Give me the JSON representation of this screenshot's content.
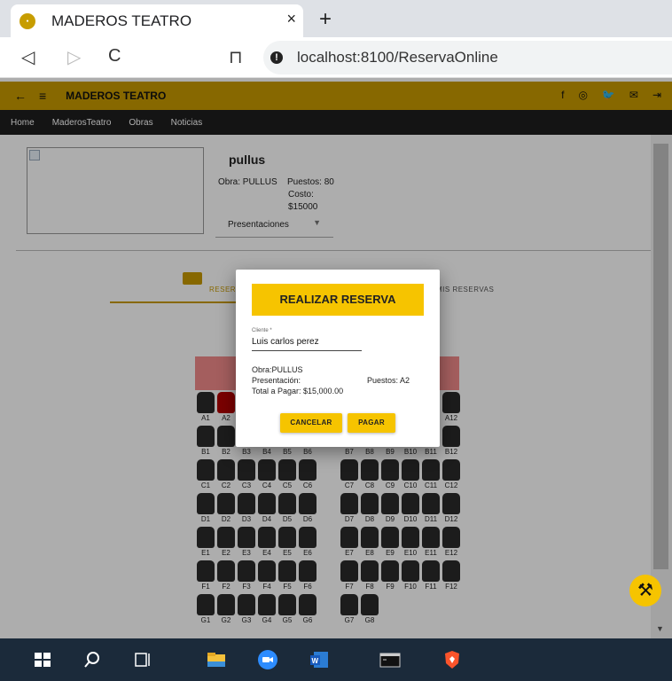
{
  "browser": {
    "tab_title": "MADEROS TEATRO",
    "tab_close": "×",
    "new_tab": "+",
    "url": "localhost:8100/ReservaOnline",
    "back": "◁",
    "forward": "▷",
    "reload": "C",
    "bookmark": "⊓",
    "info": "!"
  },
  "toolbar": {
    "back_arrow": "←",
    "menu": "≡",
    "brand": "MADEROS TEATRO",
    "social": [
      "f",
      "◎",
      "🐦",
      "✉",
      "⇥"
    ]
  },
  "menu": [
    "Home",
    "MaderosTeatro",
    "Obras",
    "Noticias"
  ],
  "obra": {
    "title": "pullus",
    "obra_line": "Obra: PULLUS",
    "puestos": "Puestos: 80",
    "costo_label": "Costo:",
    "costo_value": "$15000",
    "presentaciones": "Presentaciones"
  },
  "tabs": {
    "tab1": "RESERVAR",
    "tab2": "MIS RESERVAS"
  },
  "seats": {
    "rows": [
      "A",
      "B",
      "C",
      "D",
      "E",
      "F",
      "G"
    ],
    "left_labels": {
      "A": [
        "A1",
        "A2"
      ],
      "B": [
        "B1",
        "B2",
        "B3",
        "B4",
        "B5",
        "B6"
      ],
      "C": [
        "C1",
        "C2",
        "C3",
        "C4",
        "C5",
        "C6"
      ],
      "D": [
        "D1",
        "D2",
        "D3",
        "D4",
        "D5",
        "D6"
      ],
      "E": [
        "E1",
        "E2",
        "E3",
        "E4",
        "E5",
        "E6"
      ],
      "F": [
        "F1",
        "F2",
        "F3",
        "F4",
        "F5",
        "F6"
      ],
      "G": [
        "G1",
        "G2",
        "G3",
        "G4",
        "G5",
        "G6"
      ]
    },
    "right_labels": {
      "A": [
        "A12"
      ],
      "B": [
        "B7",
        "B8",
        "B9",
        "B10",
        "B11",
        "B12"
      ],
      "C": [
        "C7",
        "C8",
        "C9",
        "C10",
        "C11",
        "C12"
      ],
      "D": [
        "D7",
        "D8",
        "D9",
        "D10",
        "D11",
        "D12"
      ],
      "E": [
        "E7",
        "E8",
        "E9",
        "E10",
        "E11",
        "E12"
      ],
      "F": [
        "F7",
        "F8",
        "F9",
        "F10",
        "F11",
        "F12"
      ],
      "G": [
        "G7",
        "G8"
      ]
    },
    "selected": "A2"
  },
  "dialog": {
    "title": "REALIZAR RESERVA",
    "field_label": "Cliente *",
    "field_value": "Luis carlos perez",
    "obra": "Obra:PULLUS",
    "presentacion": "Presentación:",
    "puestos": "Puestos: A2",
    "total": "Total a Pagar: $15,000.00",
    "cancel": "CANCELAR",
    "pay": "PAGAR"
  },
  "fab_icon": "⚒",
  "colors": {
    "accent": "#c79a00",
    "button": "#f6c400",
    "stage": "#f28b8b",
    "seat": "#2a2a2a",
    "seat_selected": "#b40000"
  }
}
